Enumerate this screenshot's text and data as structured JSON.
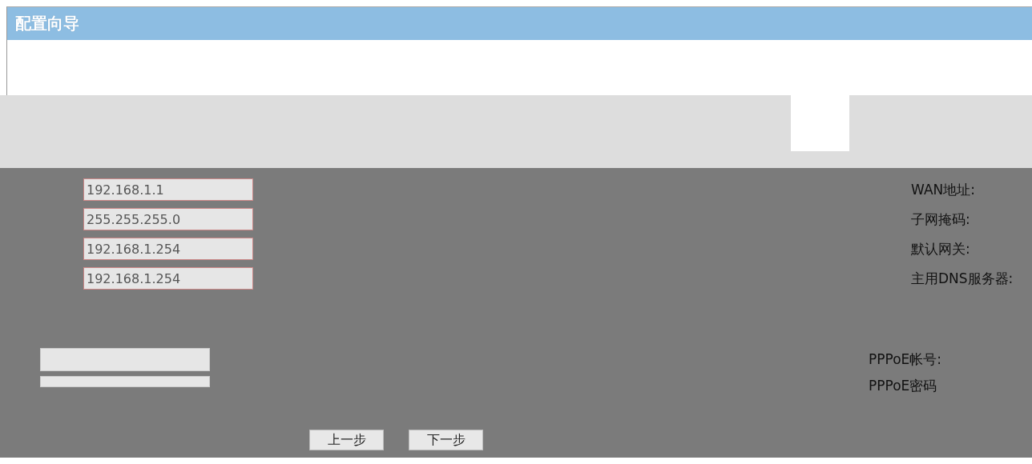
{
  "window": {
    "title": "配置向导"
  },
  "wan_fields": [
    {
      "value": "192.168.1.1"
    },
    {
      "value": "255.255.255.0"
    },
    {
      "value": "192.168.1.254"
    },
    {
      "value": "192.168.1.254"
    }
  ],
  "wan_labels": [
    "WAN地址:",
    "子网掩码:",
    "默认网关:",
    "主用DNS服务器:"
  ],
  "pppoe_fields": [
    {
      "label": "PPPoE帐号:"
    },
    {
      "label": "PPPoE密码"
    }
  ],
  "buttons": [
    "上一步",
    "下一步"
  ]
}
